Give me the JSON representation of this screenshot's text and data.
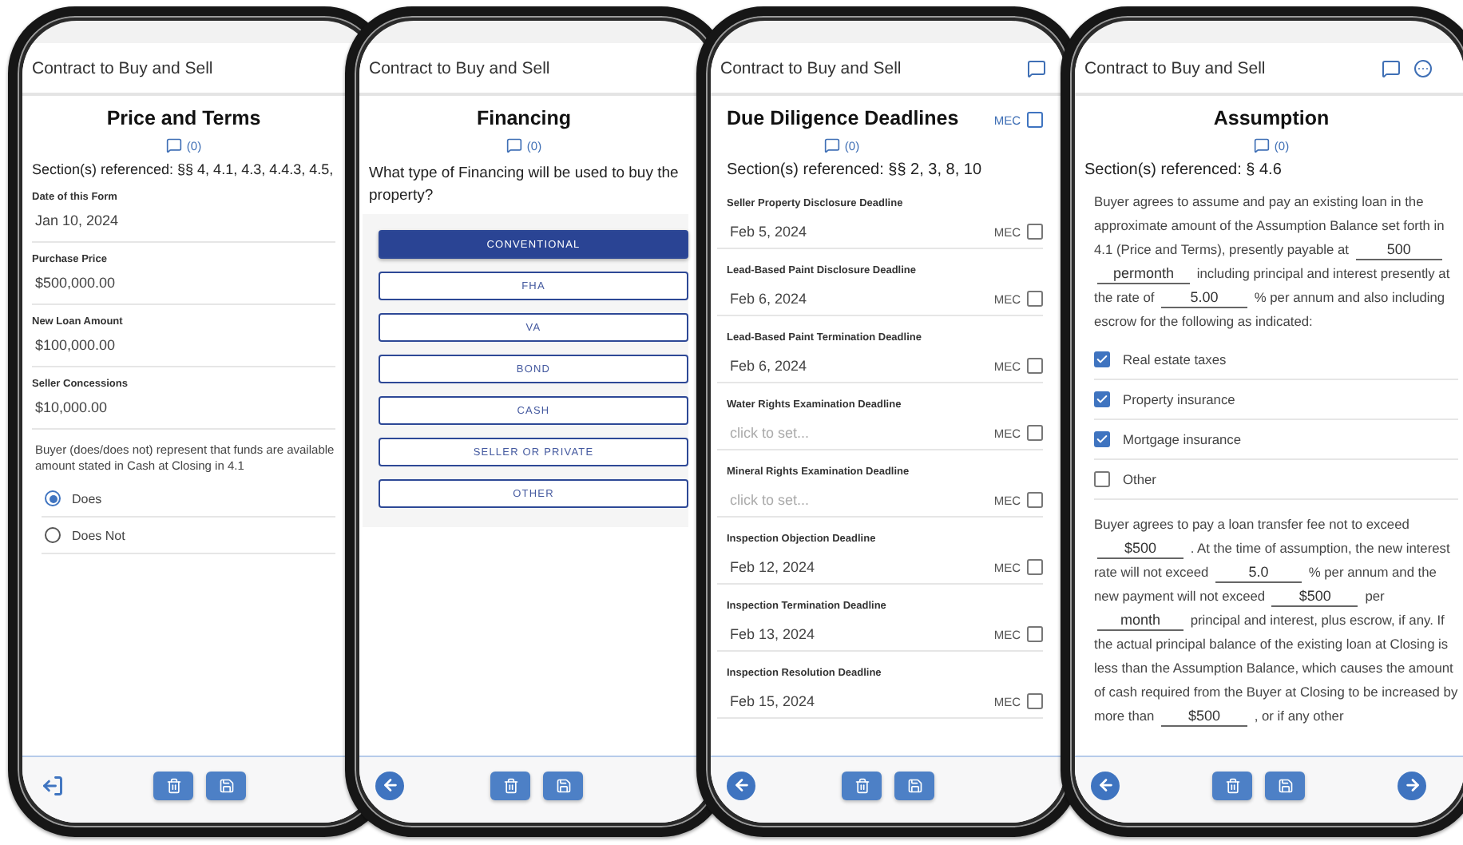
{
  "phones": [
    {
      "kind": "price_terms",
      "app_title": "Contract to Buy and Sell",
      "heading": "Price and Terms",
      "comments": "(0)",
      "sections": "Section(s) referenced: §§ 4, 4.1, 4.3, 4.4.3, 4.5,",
      "nav_back": false,
      "nav_next": false,
      "fields": [
        {
          "label": "Date of this Form",
          "value": "Jan 10, 2024"
        },
        {
          "label": "Purchase Price",
          "value": "$500,000.00"
        },
        {
          "label": "New Loan Amount",
          "value": "$100,000.00"
        },
        {
          "label": "Seller Concessions",
          "value": "$10,000.00"
        }
      ],
      "question_lines": [
        "Buyer (does/does not) represent that funds are available",
        "amount stated in Cash at Closing in 4.1"
      ],
      "radios": [
        {
          "label": "Does",
          "selected": true
        },
        {
          "label": "Does Not",
          "selected": false
        }
      ]
    },
    {
      "kind": "financing",
      "app_title": "Contract to Buy and Sell",
      "heading": "Financing",
      "comments": "(0)",
      "question": "What type of Financing will be used to buy the property?",
      "nav_back": true,
      "nav_next": false,
      "options": [
        {
          "label": "CONVENTIONAL",
          "selected": true
        },
        {
          "label": "FHA",
          "selected": false
        },
        {
          "label": "VA",
          "selected": false
        },
        {
          "label": "BOND",
          "selected": false
        },
        {
          "label": "CASH",
          "selected": false
        },
        {
          "label": "SELLER OR PRIVATE",
          "selected": false
        },
        {
          "label": "OTHER",
          "selected": false
        }
      ]
    },
    {
      "kind": "deadlines",
      "app_title": "Contract to Buy and Sell",
      "heading": "Due Diligence Deadlines",
      "mec_label": "MEC",
      "mec_checked": false,
      "comments": "(0)",
      "sections": "Section(s) referenced: §§ 2, 3, 8, 10",
      "nav_back": true,
      "nav_next": false,
      "deadlines": [
        {
          "label": "Seller Property Disclosure Deadline",
          "value": "Feb 5, 2024",
          "mec_label": "MEC",
          "mec_checked": false
        },
        {
          "label": "Lead-Based Paint Disclosure Deadline",
          "value": "Feb 6, 2024",
          "mec_label": "MEC",
          "mec_checked": false
        },
        {
          "label": "Lead-Based Paint Termination Deadline",
          "value": "Feb 6, 2024",
          "mec_label": "MEC",
          "mec_checked": false
        },
        {
          "label": "Water Rights Examination Deadline",
          "placeholder": "click to set...",
          "mec_label": "MEC",
          "mec_checked": false
        },
        {
          "label": "Mineral Rights Examination Deadline",
          "placeholder": "click to set...",
          "mec_label": "MEC",
          "mec_checked": false
        },
        {
          "label": "Inspection Objection Deadline",
          "value": "Feb 12, 2024",
          "mec_label": "MEC",
          "mec_checked": false
        },
        {
          "label": "Inspection Termination Deadline",
          "value": "Feb 13, 2024",
          "mec_label": "MEC",
          "mec_checked": false
        },
        {
          "label": "Inspection Resolution Deadline",
          "value": "Feb 15, 2024",
          "mec_label": "MEC",
          "mec_checked": false
        }
      ]
    },
    {
      "kind": "assumption",
      "app_title": "Contract to Buy and Sell",
      "heading": "Assumption",
      "comments": "(0)",
      "sections": "Section(s) referenced: § 4.6",
      "nav_back": true,
      "nav_next": true,
      "paragraph_1": [
        {
          "kind": "text",
          "text": "Buyer agrees to assume and pay an existing loan in the approximate amount of the Assumption Balance set forth in 4.1 (Price and Terms), presently payable at"
        },
        {
          "kind": "blank",
          "value": "500"
        },
        {
          "kind": "blank",
          "value": "permonth"
        },
        {
          "kind": "text",
          "text": "including principal and interest presently at the rate of"
        },
        {
          "kind": "blank",
          "value": "5.00"
        },
        {
          "kind": "text",
          "text": "% per annum and also including escrow for the following as indicated:"
        }
      ],
      "escrow_items": [
        {
          "label": "Real estate taxes",
          "checked": true
        },
        {
          "label": "Property insurance",
          "checked": true
        },
        {
          "label": "Mortgage insurance",
          "checked": true
        },
        {
          "label": "Other",
          "checked": false
        }
      ],
      "paragraph_2": [
        {
          "kind": "text",
          "text": "Buyer agrees to pay a loan transfer fee not to exceed"
        },
        {
          "kind": "blank",
          "value": "$500"
        },
        {
          "kind": "text",
          "text": ". At the time of assumption, the new interest rate will not exceed"
        },
        {
          "kind": "blank",
          "value": "5.0"
        },
        {
          "kind": "text",
          "text": "% per annum and the new payment will not exceed"
        },
        {
          "kind": "blank",
          "value": "$500"
        },
        {
          "kind": "text",
          "text": "per"
        },
        {
          "kind": "blank",
          "value": "month"
        },
        {
          "kind": "text",
          "text": "principal and interest, plus escrow, if any. If the actual principal balance of the existing loan at Closing is less than the Assumption Balance, which causes the amount of cash required from the Buyer at Closing to be increased by more than"
        },
        {
          "kind": "blank",
          "value": "$500"
        },
        {
          "kind": "text",
          "text": ", or if any other"
        }
      ]
    }
  ]
}
